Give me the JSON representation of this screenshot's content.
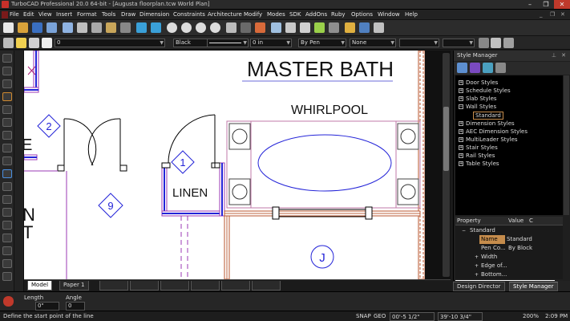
{
  "window": {
    "title": "TurboCAD Professional 20.0 64-bit - [Augusta floorplan.tcw World Plan]",
    "minimize": "–",
    "restore": "❐",
    "close": "✕"
  },
  "menu": [
    "File",
    "Edit",
    "View",
    "Insert",
    "Format",
    "Tools",
    "Draw",
    "Dimension",
    "Constraints",
    "Architecture",
    "Modify",
    "Modes",
    "SDK",
    "AddOns",
    "Ruby",
    "Options",
    "Window",
    "Help"
  ],
  "toolbar2": {
    "layer_value": "0",
    "color_value": "Black",
    "width_value": "0 in",
    "pen_value": "By Pen",
    "fill_value": "None"
  },
  "drawing": {
    "title": "MASTER BATH",
    "label_whirlpool": "WHIRLPOOL",
    "label_linen": "LINEN",
    "tag_1": "1",
    "tag_2": "2",
    "tag_9": "9",
    "tag_j": "J",
    "frag_n": "N",
    "frag_t": "T",
    "frag_e": "E"
  },
  "tabs": {
    "model": "Model",
    "paper1": "Paper 1"
  },
  "style_manager": {
    "header": "Style Manager",
    "tree": [
      {
        "label": "Door Styles",
        "expander": "+"
      },
      {
        "label": "Schedule Styles",
        "expander": "+"
      },
      {
        "label": "Slab Styles",
        "expander": "+"
      },
      {
        "label": "Wall Styles",
        "expander": "−"
      },
      {
        "label": "Standard",
        "expander": ""
      },
      {
        "label": "Dimension Styles",
        "expander": "+"
      },
      {
        "label": "AEC Dimension Styles",
        "expander": "+"
      },
      {
        "label": "MultiLeader Styles",
        "expander": "+"
      },
      {
        "label": "Stair Styles",
        "expander": "+"
      },
      {
        "label": "Rail Styles",
        "expander": "+"
      },
      {
        "label": "Table Styles",
        "expander": "+"
      }
    ],
    "grid_headers": [
      "Property",
      "Value",
      "C"
    ],
    "grid_rows": [
      {
        "name": "Standard",
        "value": "",
        "expander": "−"
      },
      {
        "name": "Name",
        "value": "Standard",
        "expander": ""
      },
      {
        "name": "Pen Co...",
        "value": "By Block",
        "expander": ""
      },
      {
        "name": "Width",
        "value": "",
        "expander": "+"
      },
      {
        "name": "Edge of...",
        "value": "",
        "expander": "+"
      },
      {
        "name": "Bottom...",
        "value": "",
        "expander": "+"
      }
    ],
    "tab_design_director": "Design Director",
    "tab_style_manager": "Style Manager"
  },
  "inspector": {
    "length_label": "Length",
    "length_value": "0\"",
    "angle_label": "Angle",
    "angle_value": "0"
  },
  "status": {
    "prompt": "Define the start point of the line",
    "snap": "SNAP",
    "geo": "GEO",
    "x_coord": "00'-5 1/2\"",
    "y_coord": "39'-10 3/4\"",
    "zoom": "200%",
    "time": "2:09 PM"
  },
  "colors": {
    "wall_purple": "#9b38b5",
    "wall_blue": "#2323d8",
    "brick": "#b8562e",
    "panel_bg": "#1f1f1f",
    "selected_tab": "#c58c4c"
  }
}
